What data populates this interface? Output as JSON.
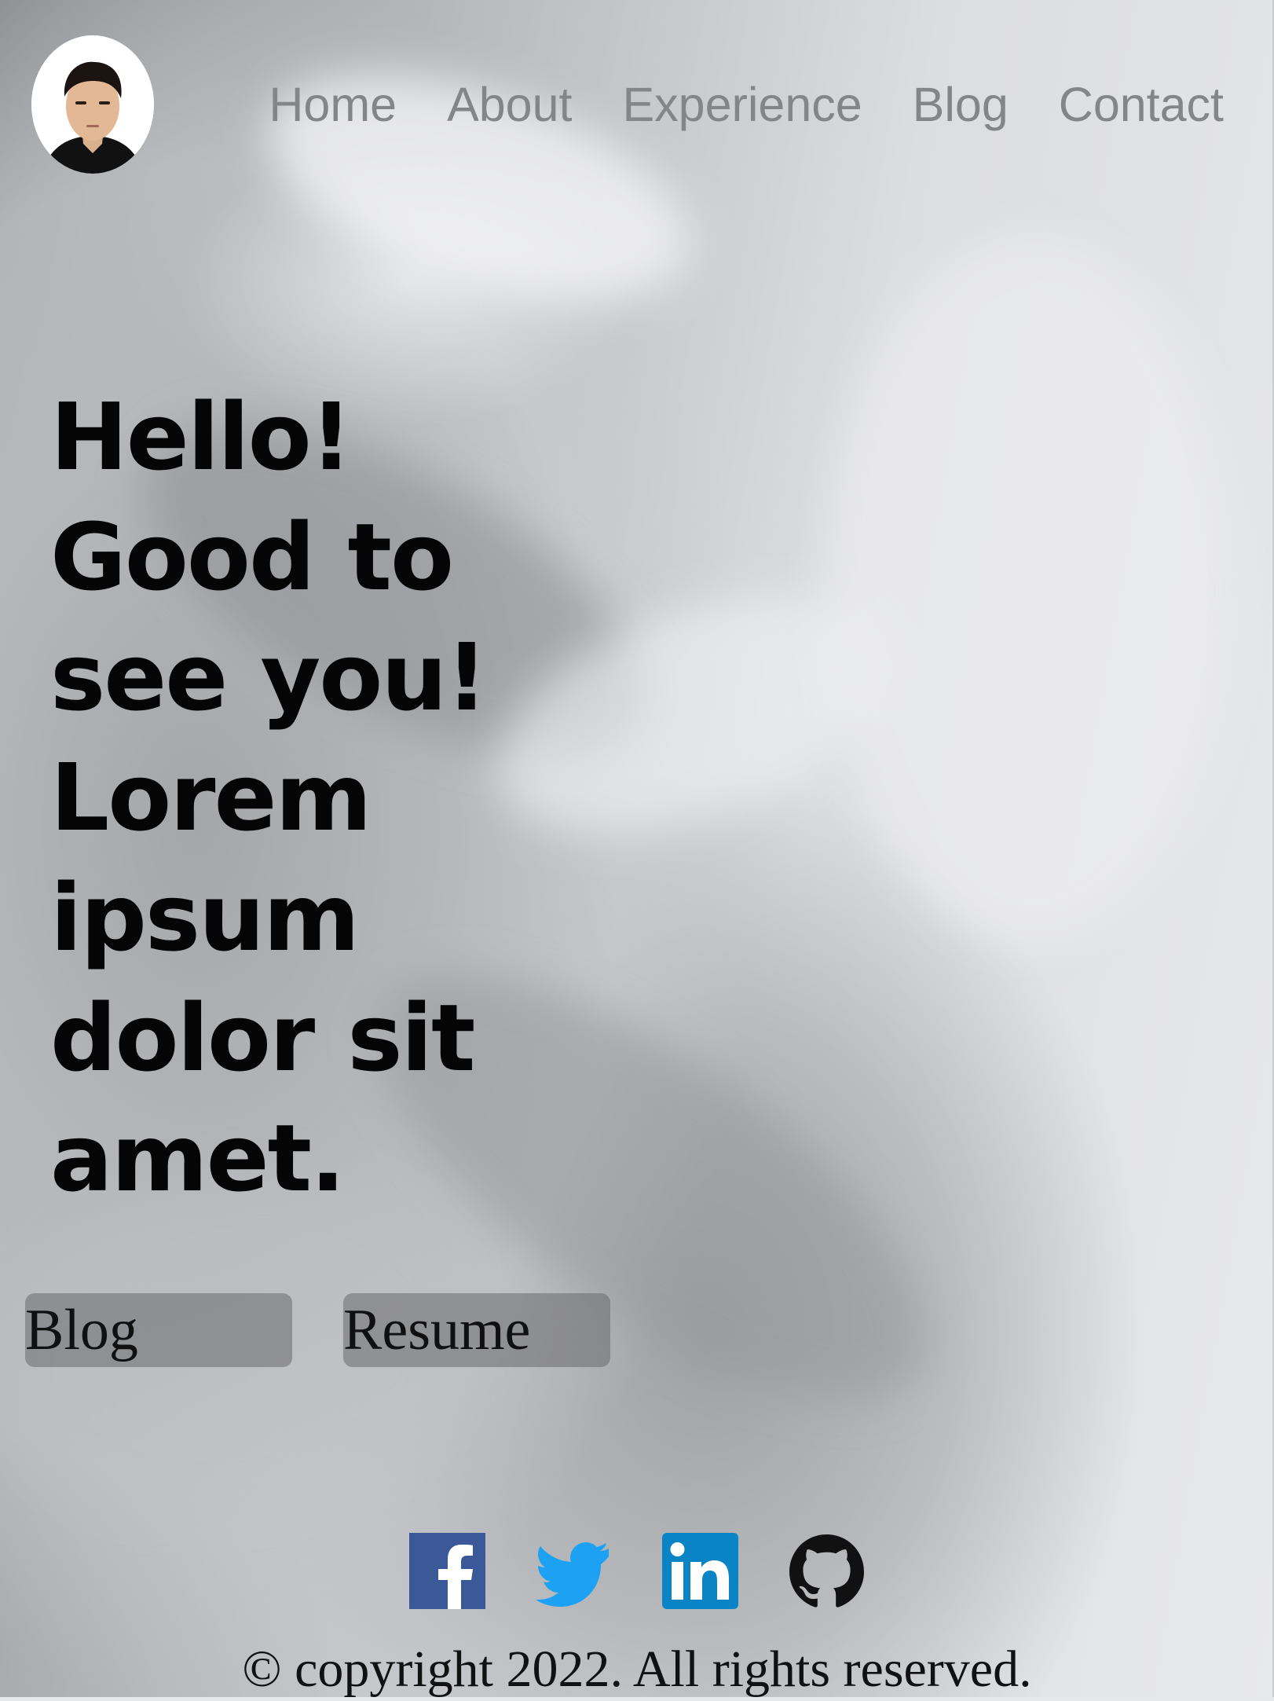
{
  "nav": {
    "avatar_alt": "profile photo",
    "links": [
      {
        "label": "Home"
      },
      {
        "label": "About"
      },
      {
        "label": "Experience"
      },
      {
        "label": "Blog"
      },
      {
        "label": "Contact"
      }
    ]
  },
  "hero": {
    "lines": [
      "Hello!",
      "Good to",
      "see you!",
      "Lorem",
      "ipsum",
      "dolor sit",
      "amet."
    ]
  },
  "cta": {
    "blog_label": "Blog",
    "resume_label": "Resume"
  },
  "social": {
    "icons": [
      "facebook-icon",
      "twitter-icon",
      "linkedin-icon",
      "github-icon"
    ],
    "colors": {
      "facebook": "#3b5998",
      "twitter": "#1da1f2",
      "linkedin": "#0a84c4",
      "github": "#111111"
    }
  },
  "footer": {
    "copyright": "© copyright 2022. All rights reserved."
  }
}
